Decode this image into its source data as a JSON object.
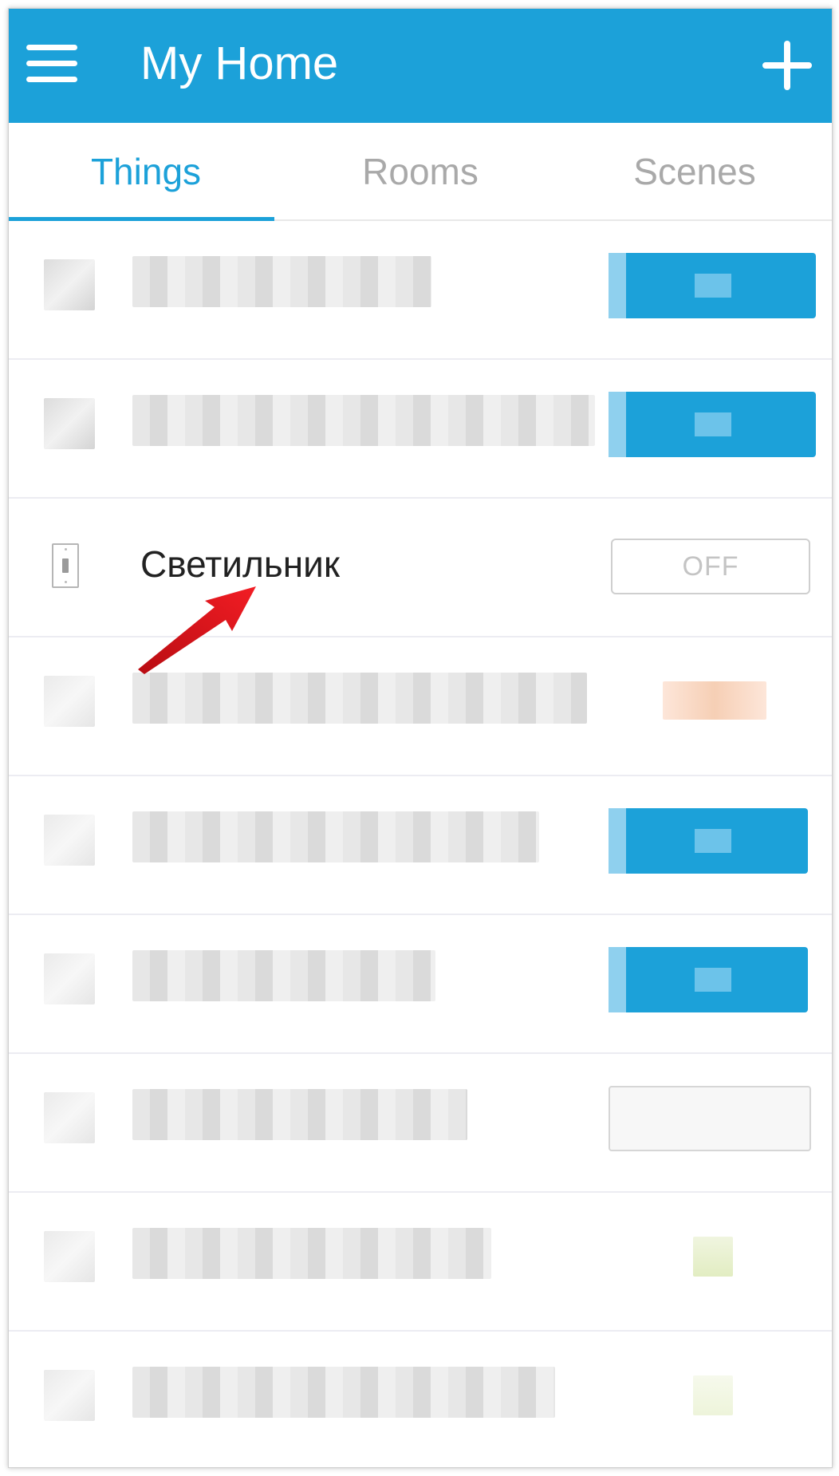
{
  "app_bar": {
    "title": "My Home",
    "menu_icon": "hamburger-menu-icon",
    "add_icon": "plus-icon",
    "color": "#1ca1d9"
  },
  "tabs": [
    {
      "label": "Things",
      "active": true
    },
    {
      "label": "Rooms",
      "active": false
    },
    {
      "label": "Scenes",
      "active": false
    }
  ],
  "highlighted_item": {
    "name": "Светильник",
    "icon": "light-switch-icon",
    "state_button_label": "OFF"
  },
  "accent_colors": {
    "primary": "#1ca1d9",
    "annotation_arrow": "#e8141c"
  }
}
